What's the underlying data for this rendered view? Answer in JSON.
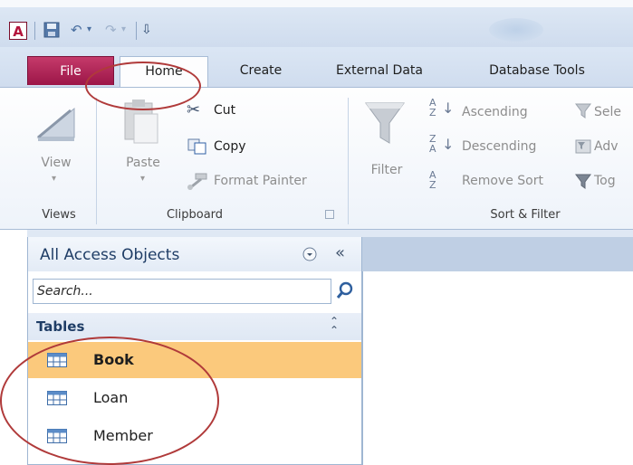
{
  "qat": {
    "app_logo": "A",
    "undo_icon": "↶",
    "redo_icon": "↷",
    "dropdown_caret": "▾",
    "customize_icon": "⇩"
  },
  "tabs": [
    {
      "label": "File"
    },
    {
      "label": "Home"
    },
    {
      "label": "Create"
    },
    {
      "label": "External Data"
    },
    {
      "label": "Database Tools"
    }
  ],
  "ribbon": {
    "views": {
      "view_label": "View",
      "group_label": "Views"
    },
    "clipboard": {
      "paste_label": "Paste",
      "cut_label": "Cut",
      "copy_label": "Copy",
      "format_painter_label": "Format Painter",
      "group_label": "Clipboard"
    },
    "sort_filter": {
      "filter_label": "Filter",
      "ascending_label": "Ascending",
      "descending_label": "Descending",
      "remove_sort_label": "Remove Sort",
      "selection_label": "Sele",
      "advanced_label": "Adv",
      "toggle_label": "Tog",
      "group_label": "Sort & Filter"
    }
  },
  "nav_pane": {
    "title": "All Access Objects",
    "collapse_icon": "«",
    "search_placeholder": "Search...",
    "section_label": "Tables",
    "section_collapse_icon": "⌃",
    "items": [
      {
        "label": "Book",
        "selected": true
      },
      {
        "label": "Loan",
        "selected": false
      },
      {
        "label": "Member",
        "selected": false
      }
    ]
  },
  "colors": {
    "file_tab": "#b3123b",
    "selected_item": "#fbc97c",
    "annotation": "#b03a3a"
  }
}
